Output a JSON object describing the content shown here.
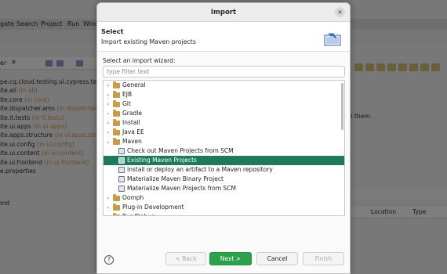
{
  "ide": {
    "menu": [
      "gate",
      "Search",
      "Project",
      "Run",
      "Wind"
    ],
    "explorer_tab": "er",
    "explorer_close": "✕",
    "tree": [
      {
        "name": "pe.cq.cloud.testing.ui.cypress.tests",
        "hint": "(i"
      },
      {
        "name": "ite.all",
        "hint": "(in all)"
      },
      {
        "name": "ite.core",
        "hint": "(in core)"
      },
      {
        "name": "ite.dispatcher.ams",
        "hint": "(in dispatcher)"
      },
      {
        "name": "ite.it.tests",
        "hint": "(in it.tests)"
      },
      {
        "name": "ite.ui.apps",
        "hint": "(in ui.apps)"
      },
      {
        "name": "ite.apps.structure",
        "hint": "(in ui.apps.struc"
      },
      {
        "name": "ite.ui.config",
        "hint": "(in ui.config)"
      },
      {
        "name": "ite.ui.content",
        "hint": "(in ui.content)"
      },
      {
        "name": "ite.ui.frontend",
        "hint": "(in ui.frontend)"
      },
      {
        "name": "e.properties",
        "hint": ""
      }
    ],
    "right_text": "en them.",
    "bottom_left": "md",
    "columns": [
      "Location",
      "Type"
    ]
  },
  "dialog": {
    "title": "Import",
    "close": "×",
    "heading": "Select",
    "subheading": "Import existing Maven projects",
    "wizard_label": "Select an import wizard:",
    "filter_placeholder": "type filter text",
    "filter_value": "",
    "items": [
      {
        "label": "General",
        "level": 0,
        "type": "folder",
        "expanded": false
      },
      {
        "label": "EJB",
        "level": 0,
        "type": "folder",
        "expanded": false
      },
      {
        "label": "Git",
        "level": 0,
        "type": "folder",
        "expanded": false
      },
      {
        "label": "Gradle",
        "level": 0,
        "type": "folder",
        "expanded": false
      },
      {
        "label": "Install",
        "level": 0,
        "type": "folder",
        "expanded": false
      },
      {
        "label": "Java EE",
        "level": 0,
        "type": "folder",
        "expanded": false
      },
      {
        "label": "Maven",
        "level": 0,
        "type": "folder",
        "expanded": true
      },
      {
        "label": "Check out Maven Projects from SCM",
        "level": 1,
        "type": "item"
      },
      {
        "label": "Existing Maven Projects",
        "level": 1,
        "type": "item",
        "selected": true
      },
      {
        "label": "Install or deploy an artifact to a Maven repository",
        "level": 1,
        "type": "item"
      },
      {
        "label": "Materialize Maven Binary Project",
        "level": 1,
        "type": "item"
      },
      {
        "label": "Materialize Maven Projects from SCM",
        "level": 1,
        "type": "item"
      },
      {
        "label": "Oomph",
        "level": 0,
        "type": "folder",
        "expanded": false
      },
      {
        "label": "Plug-in Development",
        "level": 0,
        "type": "folder",
        "expanded": false
      },
      {
        "label": "Run/Debug",
        "level": 0,
        "type": "folder",
        "expanded": false
      }
    ],
    "buttons": {
      "help": "?",
      "back": "< Back",
      "next": "Next >",
      "cancel": "Cancel",
      "finish": "Finish"
    }
  },
  "colors": {
    "selection": "#1f7a5a",
    "primary_button": "#2aa14a",
    "overlay": "#787878"
  }
}
